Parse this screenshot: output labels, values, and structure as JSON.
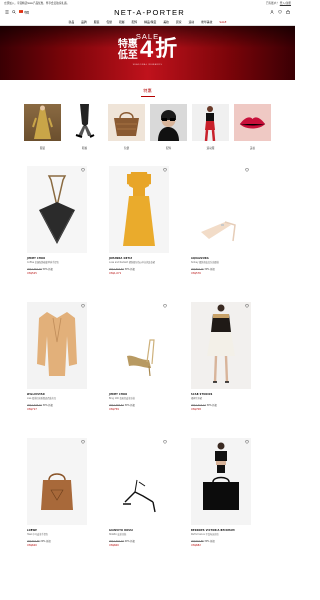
{
  "topbar": {
    "promo": "立即加入，享受精选Sale产品优惠，尊享会员独家礼遇。",
    "login_prompt": "已有账户？",
    "login_link": "登入/注册"
  },
  "header": {
    "country": "中国",
    "logo": "NET-A-PORTER"
  },
  "nav": [
    "新品",
    "品牌",
    "服装",
    "包袋",
    "鞋履",
    "配饰",
    "精品/珠宝",
    "美妆",
    "居家",
    "运动",
    "奢华美妆",
    "SALE"
  ],
  "banner": {
    "title": "SALE",
    "line1": "特惠",
    "line2": "低至",
    "big_digit": "4",
    "big_char": "折",
    "note": "SEASONAL REWARDS"
  },
  "categories": {
    "heading": "特惠",
    "items": [
      {
        "label": "服装"
      },
      {
        "label": "鞋履"
      },
      {
        "label": "包袋"
      },
      {
        "label": "配饰"
      },
      {
        "label": "运动服"
      },
      {
        "label": "美妆"
      }
    ]
  },
  "products": [
    {
      "brand": "JIMMY CHOO",
      "desc": "Coffee 金属配饰编织单肩手提包",
      "was": "US$1,051.26",
      "discount": "50% 折扣",
      "now": "US$525"
    },
    {
      "brand": "JOHANNA ORTIZ",
      "desc": "Luxe and Radiant 褶饰细节绉纱中长款连衣裙",
      "was": "US$1,664.59",
      "discount": "30% 折扣",
      "now": "US$1,071"
    },
    {
      "brand": "AQUAZZURA",
      "desc": "Sidney 缀饰漆皮尖头高跟鞋",
      "was": "US$824.16",
      "discount": "30% 折扣",
      "now": "US$576"
    },
    {
      "brand": "WILLIUSTAN",
      "desc": "Lisa 双排扣丝质缎面西装夹克",
      "was": "US$1,029.16",
      "discount": "30% 折扣",
      "now": "US$717"
    },
    {
      "brand": "JIMMY CHOO",
      "desc": "Bing 100 金属色皮革凉鞋",
      "was": "US$1,084.54",
      "discount": "30% 折扣",
      "now": "US$759"
    },
    {
      "brand": "SCAB STUDIOS",
      "desc": "褶裥半身裙",
      "was": "US$1,012.17",
      "discount": "30% 折扣",
      "now": "US$708"
    },
    {
      "brand": "LOEWE",
      "desc": "Heel 中号皮革手提包",
      "was": "US$774.68",
      "discount": "20% 折扣",
      "now": "US$620"
    },
    {
      "brand": "GIANVITO ROSSI",
      "desc": "Stiletto 皮革凉鞋",
      "was": "US$1,001.03",
      "discount": "40% 折扣",
      "now": "US$600"
    },
    {
      "brand": "BEDDOES VICTORIA BECKHAM",
      "desc": "Performance 平纹布运动包",
      "was": "US$974.88",
      "discount": "30% 折扣",
      "now": "US$682"
    }
  ],
  "colors": {
    "accent": "#b40000",
    "banner": "#9a0a12"
  }
}
